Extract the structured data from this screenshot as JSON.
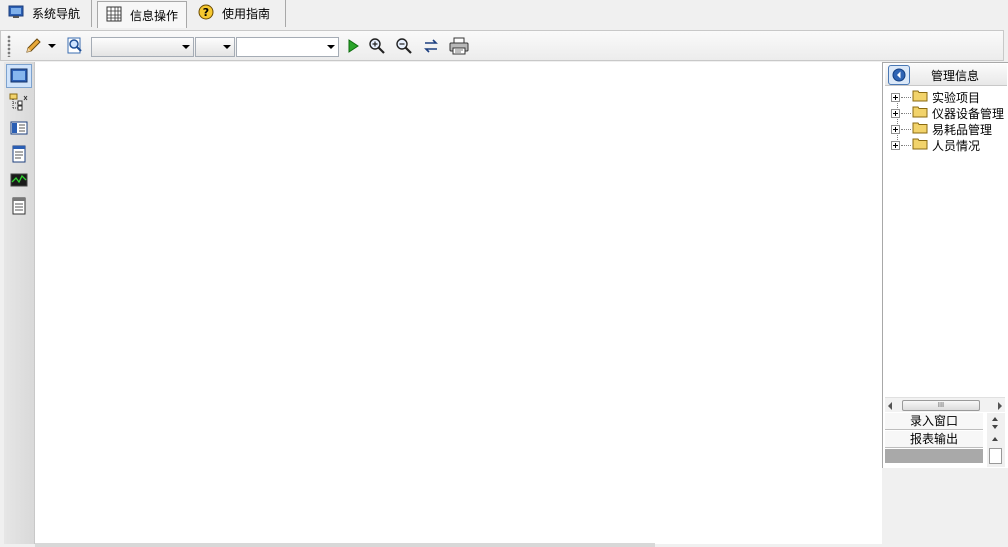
{
  "tabs": [
    {
      "label": "系统导航",
      "icon": "monitor-icon"
    },
    {
      "label": "信息操作",
      "icon": "grid-table-icon"
    },
    {
      "label": "使用指南",
      "icon": "help-icon"
    }
  ],
  "toolbar": {
    "buttons": [
      "edit-pencil-icon",
      "dropdown-arrow-icon",
      "preview-magnifier-icon",
      "run-icon",
      "zoom-in-icon",
      "zoom-out-icon",
      "refresh-icon",
      "print-icon"
    ],
    "combo1_value": "",
    "combo2_value": "",
    "combo3_value": ""
  },
  "leftbar": {
    "buttons": [
      "window-icon",
      "tree-structure-icon",
      "book-icon",
      "document-icon",
      "chart-icon",
      "report-icon"
    ]
  },
  "right_panel": {
    "title": "管理信息",
    "tree_items": [
      "实验项目",
      "仪器设备管理",
      "易耗品管理",
      "人员情况"
    ],
    "scroll_thumb_label": "III",
    "bottom_items": [
      "录入窗口",
      "报表输出"
    ]
  },
  "colors": {
    "folder": "#f2d36b",
    "run_green": "#2aa52a",
    "selection": "#cfe3fb"
  }
}
